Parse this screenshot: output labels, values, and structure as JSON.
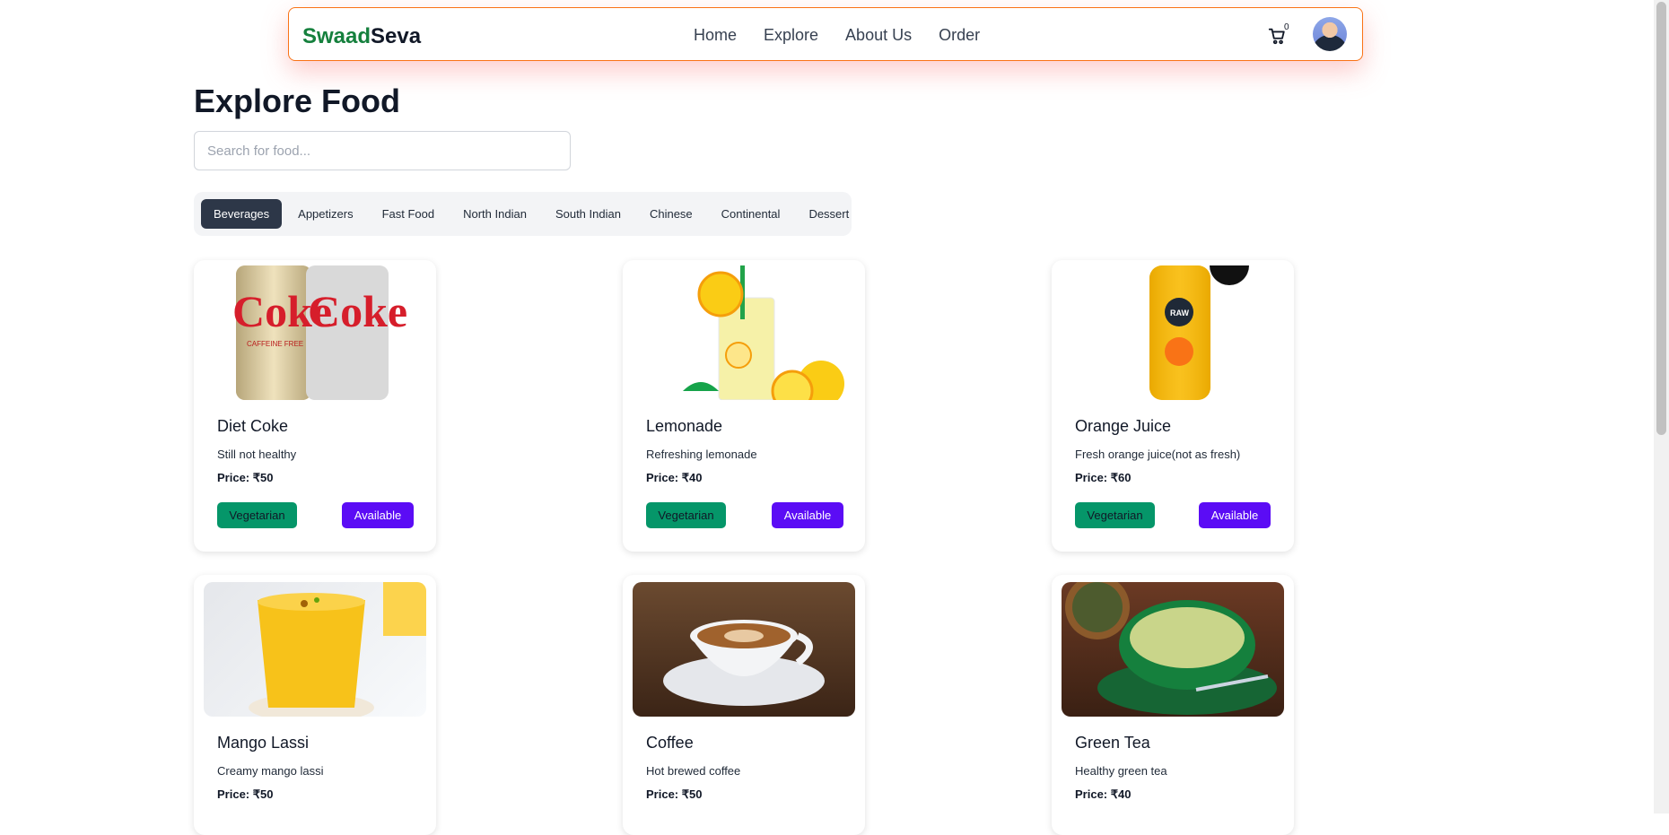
{
  "brand": {
    "part1": "Swaad",
    "part2": "Seva"
  },
  "nav": {
    "home": "Home",
    "explore": "Explore",
    "about": "About Us",
    "order": "Order"
  },
  "cart": {
    "count": "0",
    "icon": "cart-icon"
  },
  "avatar": {
    "icon": "user-avatar"
  },
  "page": {
    "title": "Explore Food"
  },
  "search": {
    "placeholder": "Search for food..."
  },
  "categories": [
    "Beverages",
    "Appetizers",
    "Fast Food",
    "North Indian",
    "South Indian",
    "Chinese",
    "Continental",
    "Dessert"
  ],
  "active_category": "Beverages",
  "items": [
    {
      "name": "Diet Coke",
      "desc": "Still not healthy",
      "price": "Price: ₹50",
      "veg": "Vegetarian",
      "status": "Available"
    },
    {
      "name": "Lemonade",
      "desc": "Refreshing lemonade",
      "price": "Price: ₹40",
      "veg": "Vegetarian",
      "status": "Available"
    },
    {
      "name": "Orange Juice",
      "desc": "Fresh orange juice(not as fresh)",
      "price": "Price: ₹60",
      "veg": "Vegetarian",
      "status": "Available"
    },
    {
      "name": "Mango Lassi",
      "desc": "Creamy mango lassi",
      "price": "Price: ₹50"
    },
    {
      "name": "Coffee",
      "desc": "Hot brewed coffee",
      "price": "Price: ₹50"
    },
    {
      "name": "Green Tea",
      "desc": "Healthy green tea",
      "price": "Price: ₹40"
    }
  ],
  "colors": {
    "accent": "#5b0cf5",
    "veg": "#059669",
    "brand_green": "#15803d",
    "nav_border": "#f97316"
  }
}
